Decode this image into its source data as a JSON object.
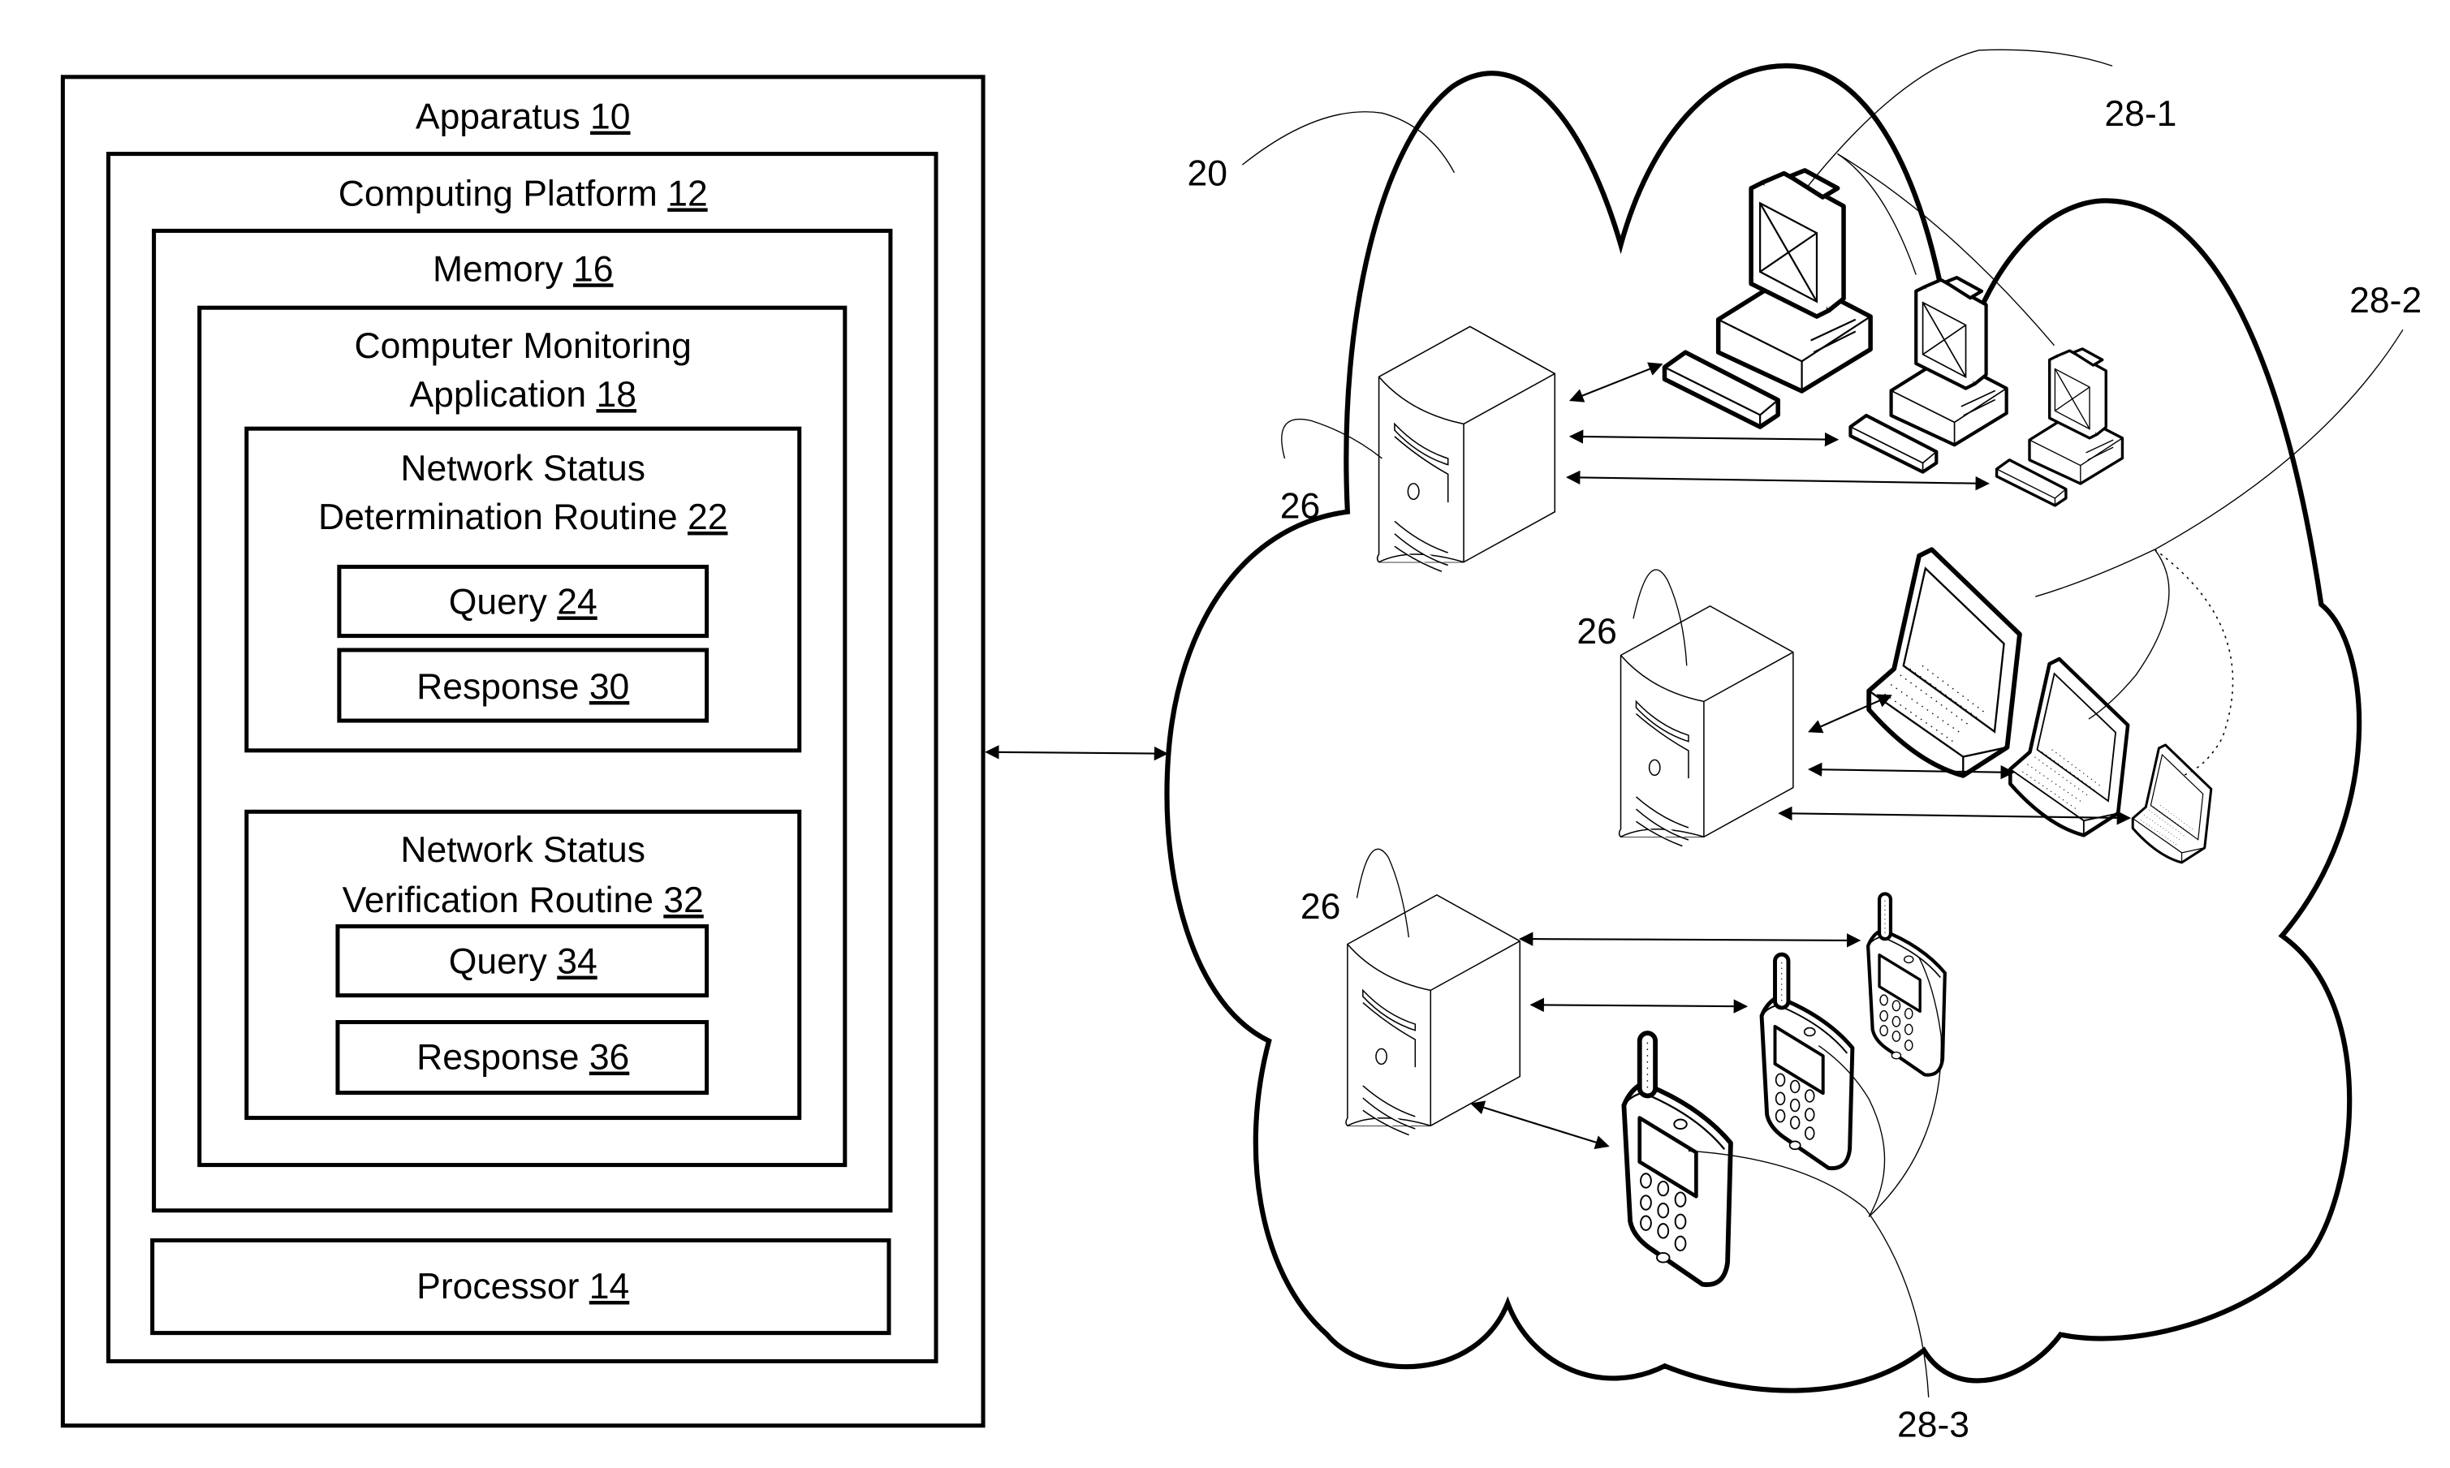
{
  "figure": {
    "apparatus": {
      "title": "Apparatus",
      "ref": "10",
      "computing_platform": {
        "title": "Computing Platform",
        "ref": "12",
        "memory": {
          "title": "Memory",
          "ref": "16",
          "application": {
            "title_line1": "Computer Monitoring",
            "title_line2": "Application",
            "ref": "18",
            "determination_routine": {
              "title_line1": "Network Status",
              "title_line2": "Determination Routine",
              "ref": "22",
              "query": {
                "title": "Query",
                "ref": "24"
              },
              "response": {
                "title": "Response",
                "ref": "30"
              }
            },
            "verification_routine": {
              "title_line1": "Network Status",
              "title_line2": "Verification Routine",
              "ref": "32",
              "query": {
                "title": "Query",
                "ref": "34"
              },
              "response": {
                "title": "Response",
                "ref": "36"
              }
            }
          }
        },
        "processor": {
          "title": "Processor",
          "ref": "14"
        }
      }
    },
    "network": {
      "ref": "20",
      "server_refs": [
        "26",
        "26",
        "26"
      ],
      "device_groups": [
        {
          "ref": "28-1",
          "device_type": "desktop-computer",
          "count": 3
        },
        {
          "ref": "28-2",
          "device_type": "laptop",
          "count": 3
        },
        {
          "ref": "28-3",
          "device_type": "mobile-phone",
          "count": 3
        }
      ]
    }
  }
}
